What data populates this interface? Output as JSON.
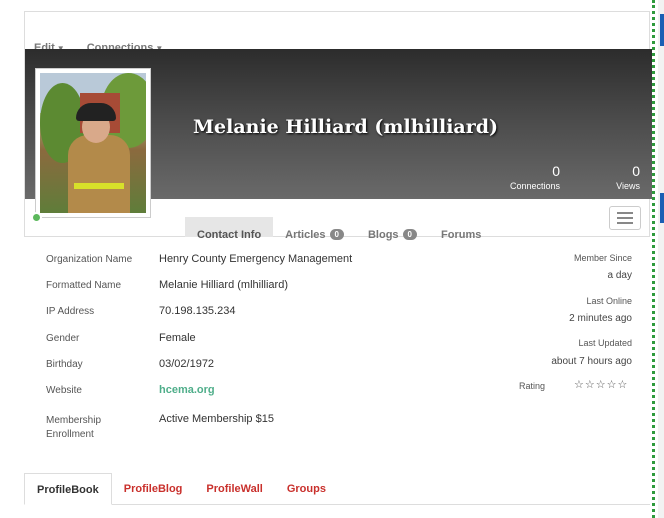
{
  "topmenu": {
    "edit": "Edit",
    "connections": "Connections"
  },
  "profile": {
    "name": "Melanie Hilliard (mlhilliard)",
    "connections_count": "0",
    "connections_label": "Connections",
    "views_count": "0",
    "views_label": "Views",
    "online_status_color": "#5cb85c"
  },
  "tabs": [
    {
      "label": "Contact Info",
      "active": true
    },
    {
      "label": "Articles",
      "badge": "0"
    },
    {
      "label": "Blogs",
      "badge": "0"
    },
    {
      "label": "Forums"
    }
  ],
  "details": [
    {
      "label": "Organization Name",
      "value": "Henry County Emergency Management"
    },
    {
      "label": "Formatted Name",
      "value": "Melanie Hilliard (mlhilliard)"
    },
    {
      "label": "IP Address",
      "value": "70.198.135.234"
    },
    {
      "label": "Gender",
      "value": "Female"
    },
    {
      "label": "Birthday",
      "value": "03/02/1972"
    },
    {
      "label": "Website",
      "value": "hcema.org"
    },
    {
      "label": "Membership Enrollment",
      "value": "Active Membership $15"
    }
  ],
  "side": {
    "member_since_label": "Member Since",
    "member_since_value": "a day",
    "last_online_label": "Last Online",
    "last_online_value": "2 minutes ago",
    "last_updated_label": "Last Updated",
    "last_updated_value": "about 7 hours ago",
    "rating_label": "Rating",
    "rating_stars": "☆☆☆☆☆"
  },
  "bottom_tabs": [
    {
      "label": "ProfileBook",
      "active": true
    },
    {
      "label": "ProfileBlog"
    },
    {
      "label": "ProfileWall"
    },
    {
      "label": "Groups"
    }
  ],
  "colors": {
    "accent_link": "#c9302c",
    "website_link": "#4fae8a"
  }
}
